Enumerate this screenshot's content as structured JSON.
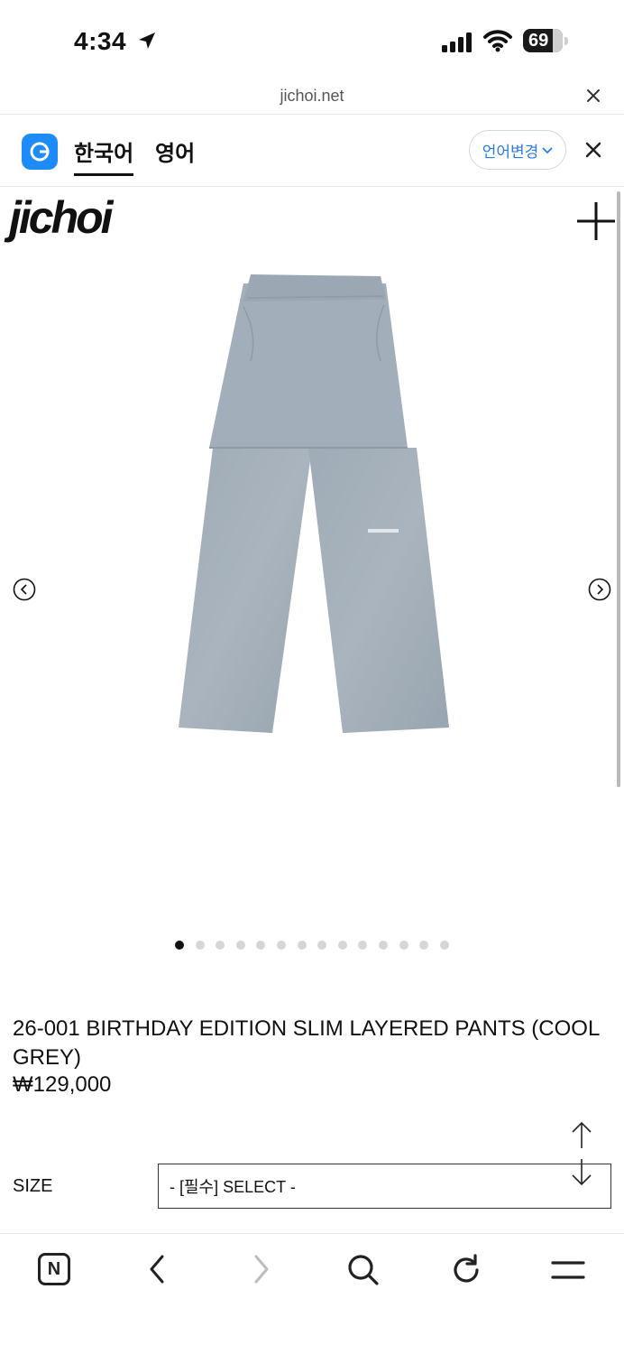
{
  "status_bar": {
    "time": "4:34",
    "battery": "69",
    "icons": [
      "location-arrow-icon",
      "signal-icon",
      "wifi-icon",
      "battery-icon"
    ]
  },
  "url_bar": {
    "url": "jichoi.net",
    "close_icon": "close-icon"
  },
  "translate_bar": {
    "tabs": [
      {
        "label": "한국어",
        "active": true
      },
      {
        "label": "영어",
        "active": false
      }
    ],
    "change_button": "언어변경",
    "accent_color": "#1d8cf8"
  },
  "site": {
    "logo": "jichoi",
    "menu_icon": "plus-icon"
  },
  "carousel": {
    "slide_count": 14,
    "active_index": 0,
    "image_alt_icon": "product-image"
  },
  "product": {
    "name": "26-001 BIRTHDAY EDITION SLIM LAYERED PANTS (COOL GREY)",
    "price": "₩129,000"
  },
  "options": {
    "size_label": "SIZE",
    "size_select_value": "- [필수] SELECT -"
  },
  "bottom_toolbar": {
    "n_label": "N",
    "icons": [
      "n-home-icon",
      "back-icon",
      "forward-icon",
      "search-icon",
      "reload-icon",
      "menu-icon"
    ]
  }
}
